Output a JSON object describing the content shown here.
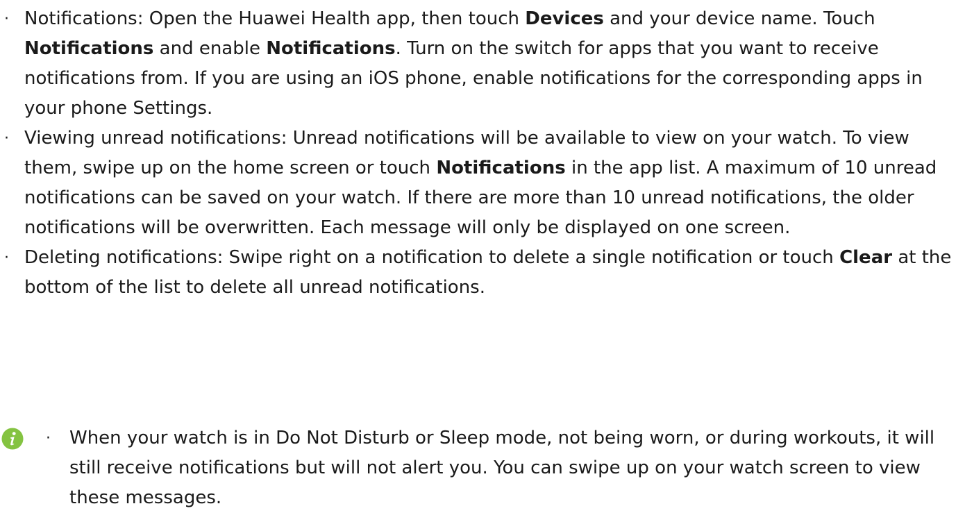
{
  "bullets": [
    {
      "p0": "Notifications: Open the Huawei Health app, then touch ",
      "b0": "Devices",
      "p1": " and your device name. Touch ",
      "b1": "Notifications",
      "p2": " and enable ",
      "b2": "Notifications",
      "p3": ". Turn on the switch for apps that you want to receive notifications from. If you are using an iOS phone, enable notifications for the corresponding apps in your phone Settings."
    },
    {
      "p0": "Viewing unread notifications: Unread notifications will be available to view on your watch. To view them, swipe up on the home screen or touch ",
      "b0": "Notifications",
      "p1": " in the app list. A maximum of 10 unread notifications can be saved on your watch. If there are more than 10 unread notifications, the older notifications will be overwritten. Each message will only be displayed on one screen."
    },
    {
      "p0": "Deleting notifications: Swipe right on a notification to delete a single notification or touch ",
      "b0": "Clear",
      "p1": " at the bottom of the list to delete all unread notifications."
    }
  ],
  "note": {
    "icon": "info-icon",
    "icon_color": "#84c341",
    "text": "When your watch is in Do Not Disturb or Sleep mode, not being worn, or during workouts, it will still receive notifications but will not alert you. You can swipe up on your watch screen to view these messages."
  },
  "bullet_glyph": "·"
}
